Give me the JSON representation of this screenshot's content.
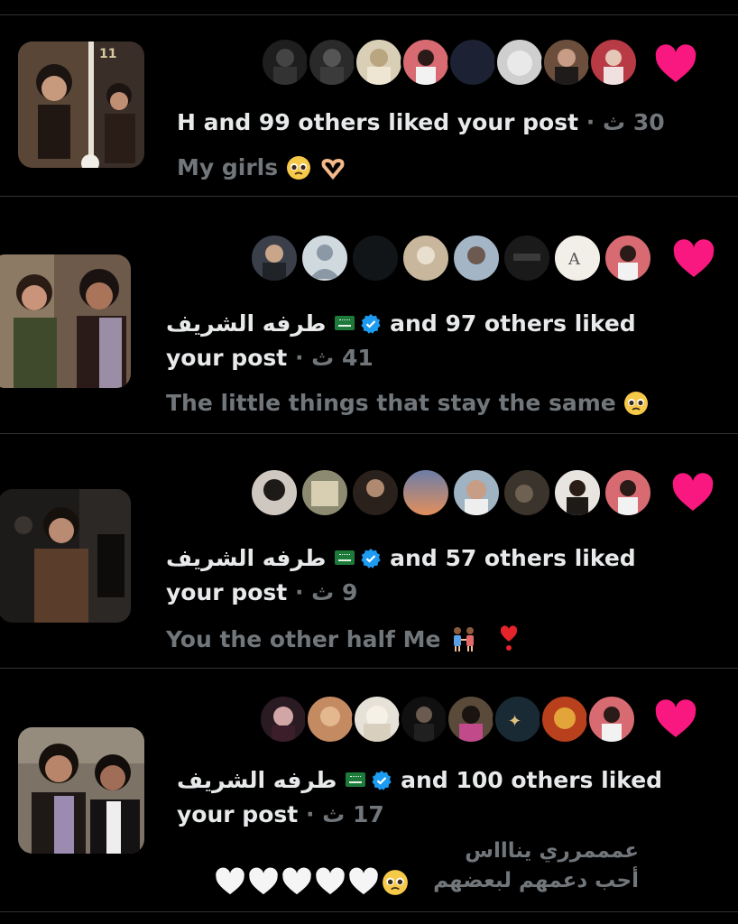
{
  "colors": {
    "background": "#000000",
    "heart": "#f91880",
    "muted": "#71767b",
    "text": "#e7e9ea",
    "verified": "#1d9bf0",
    "divider": "#2f3336"
  },
  "notifications": [
    {
      "actor": "H",
      "action": "and 99 others liked your post",
      "sep": "·",
      "time": "30 ث",
      "quote": "My girls",
      "quote_emoji": [
        "pleading-face-emoji",
        "heart-hands-emoji"
      ],
      "icon": "heart-icon",
      "avatar_count": 8
    },
    {
      "actor": "طرفه الشريف",
      "action_line1": "and 97 others liked",
      "action_line2": "your post",
      "sep": "·",
      "time": "41 ث",
      "quote": "The little things that stay the same",
      "quote_emoji": [
        "pleading-face-emoji"
      ],
      "icon": "heart-icon",
      "badges": [
        "saudi-flag-icon",
        "verified-badge-icon"
      ],
      "avatar_count": 8
    },
    {
      "actor": "طرفه الشريف",
      "action_line1": "and 57 others liked",
      "action_line2": "your post",
      "sep": "·",
      "time": "9 ث",
      "quote": "You the other half Me",
      "quote_emoji": [
        "two-women-holding-hands-emoji",
        "exclamation-heart-emoji"
      ],
      "icon": "heart-icon",
      "badges": [
        "saudi-flag-icon",
        "verified-badge-icon"
      ],
      "avatar_count": 8
    },
    {
      "actor": "طرفه الشريف",
      "action_line1": "and 100 others liked",
      "action_line2": "your post",
      "sep": "·",
      "time": "17 ث",
      "quote_line1": "عمممرري يناااس",
      "quote_line2": "أحب دعمهم لبعضهم",
      "quote_emoji": [
        "pleading-face-emoji",
        "white-heart-emoji",
        "white-heart-emoji",
        "white-heart-emoji",
        "white-heart-emoji",
        "white-heart-emoji"
      ],
      "icon": "heart-icon",
      "badges": [
        "saudi-flag-icon",
        "verified-badge-icon"
      ],
      "avatar_count": 8
    }
  ]
}
